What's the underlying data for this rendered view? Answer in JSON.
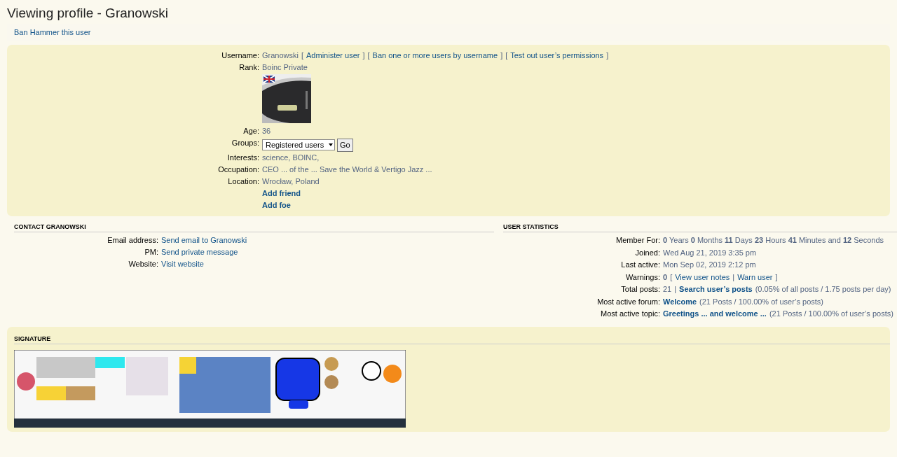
{
  "page_title": "Viewing profile - Granowski",
  "actions": [
    {
      "label": "Ban Hammer this user"
    }
  ],
  "profile": {
    "rows": [
      {
        "kind": "text",
        "label": "Username:",
        "segments": [
          {
            "kind": "text",
            "text": "Granowski"
          },
          {
            "kind": "sep",
            "text": "["
          },
          {
            "kind": "link",
            "text": "Administer user"
          },
          {
            "kind": "sep",
            "text": "]"
          },
          {
            "kind": "sep",
            "text": "["
          },
          {
            "kind": "link",
            "text": "Ban one or more users by username"
          },
          {
            "kind": "sep",
            "text": "]"
          },
          {
            "kind": "sep",
            "text": "["
          },
          {
            "kind": "link",
            "text": "Test out user’s permissions"
          },
          {
            "kind": "sep",
            "text": "]"
          }
        ]
      },
      {
        "kind": "text",
        "label": "Rank:",
        "segments": [
          {
            "kind": "text",
            "text": "Boinc Private"
          }
        ]
      },
      {
        "kind": "avatar"
      },
      {
        "kind": "text",
        "label": "Age:",
        "segments": [
          {
            "kind": "text",
            "text": "36"
          }
        ]
      },
      {
        "kind": "select",
        "label": "Groups:",
        "value": "Registered users",
        "button": "Go"
      },
      {
        "kind": "text",
        "label": "Interests:",
        "segments": [
          {
            "kind": "text",
            "text": "science, BOINC,"
          }
        ]
      },
      {
        "kind": "text",
        "label": "Occupation:",
        "segments": [
          {
            "kind": "text",
            "text": "CEO ... of the ... Save the World & Vertigo Jazz ..."
          }
        ]
      },
      {
        "kind": "text",
        "label": "Location:",
        "segments": [
          {
            "kind": "text",
            "text": "Wrocław, Poland"
          }
        ]
      },
      {
        "kind": "text",
        "segments": [
          {
            "kind": "bold-link",
            "text": "Add friend"
          }
        ]
      },
      {
        "kind": "text",
        "segments": [
          {
            "kind": "bold-link",
            "text": "Add foe"
          }
        ]
      }
    ]
  },
  "contact": {
    "title": "CONTACT GRANOWSKI",
    "rows": [
      {
        "label": "Email address:",
        "segments": [
          {
            "kind": "link",
            "text": "Send email to Granowski"
          }
        ]
      },
      {
        "label": "PM:",
        "segments": [
          {
            "kind": "link",
            "text": "Send private message"
          }
        ]
      },
      {
        "label": "Website:",
        "segments": [
          {
            "kind": "link",
            "text": "Visit website"
          }
        ]
      }
    ]
  },
  "statistics": {
    "title": "USER STATISTICS",
    "rows": [
      {
        "label": "Member For:",
        "segments": [
          {
            "kind": "rich",
            "text": "**0** Years **0** Months **11** Days **23** Hours **41** Minutes and **12** Seconds"
          }
        ]
      },
      {
        "label": "Joined:",
        "segments": [
          {
            "kind": "text",
            "text": "Wed Aug 21, 2019 3:35 pm"
          }
        ]
      },
      {
        "label": "Last active:",
        "segments": [
          {
            "kind": "text",
            "text": "Mon Sep 02, 2019 2:12 pm"
          }
        ]
      },
      {
        "label": "Warnings:",
        "segments": [
          {
            "kind": "bold",
            "text": "0"
          },
          {
            "kind": "sep",
            "text": "["
          },
          {
            "kind": "link",
            "text": "View user notes"
          },
          {
            "kind": "sep",
            "text": "|"
          },
          {
            "kind": "link",
            "text": "Warn user"
          },
          {
            "kind": "sep",
            "text": "]"
          }
        ]
      },
      {
        "label": "Total posts:",
        "segments": [
          {
            "kind": "text",
            "text": "21"
          },
          {
            "kind": "sep",
            "text": "|"
          },
          {
            "kind": "bold-link",
            "text": "Search user’s posts"
          }
        ],
        "note": "(0.05% of all posts / 1.75 posts per day)"
      },
      {
        "label": "Most active forum:",
        "segments": [
          {
            "kind": "bold-link",
            "text": "Welcome"
          }
        ],
        "note": "(21 Posts / 100.00% of user’s posts)"
      },
      {
        "label": "Most active topic:",
        "segments": [
          {
            "kind": "bold-link",
            "text": "Greetings ... and welcome ..."
          }
        ],
        "note": "(21 Posts / 100.00% of user’s posts)"
      }
    ]
  },
  "signature": {
    "title": "SIGNATURE"
  }
}
